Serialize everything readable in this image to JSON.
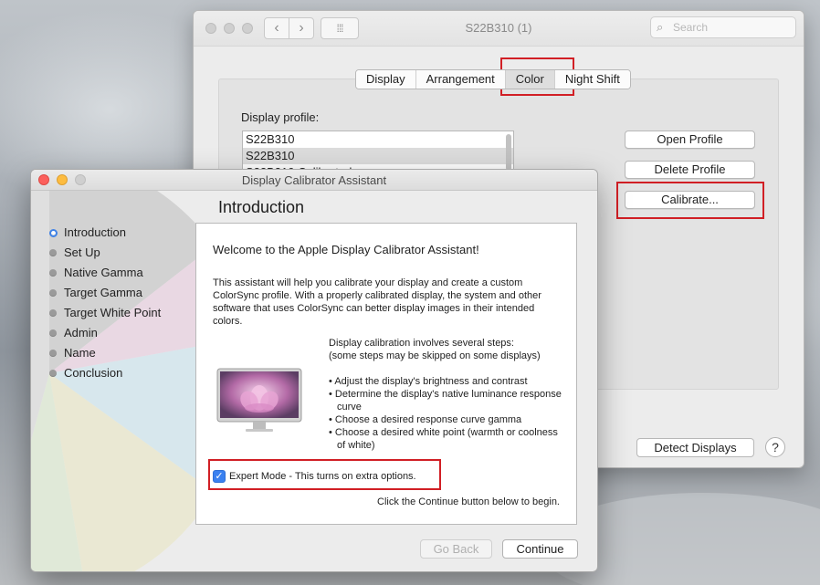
{
  "prefs_window": {
    "title": "S22B310 (1)",
    "search_placeholder": "Search",
    "tabs": [
      {
        "label": "Display",
        "selected": false
      },
      {
        "label": "Arrangement",
        "selected": false
      },
      {
        "label": "Color",
        "selected": true
      },
      {
        "label": "Night Shift",
        "selected": false
      }
    ],
    "display_profile_label": "Display profile:",
    "profiles": [
      "S22B310",
      "S22B310",
      "S22B310 Calibrated"
    ],
    "selected_profile_index": 1,
    "buttons": {
      "open_profile": "Open Profile",
      "delete_profile": "Delete Profile",
      "calibrate": "Calibrate...",
      "detect_displays": "Detect Displays",
      "help": "?"
    }
  },
  "calibrator_window": {
    "title": "Display Calibrator Assistant",
    "heading": "Introduction",
    "steps": [
      "Introduction",
      "Set Up",
      "Native Gamma",
      "Target Gamma",
      "Target White Point",
      "Admin",
      "Name",
      "Conclusion"
    ],
    "current_step_index": 0,
    "welcome": "Welcome to the Apple Display Calibrator Assistant!",
    "intro": "This assistant will help you calibrate your display and create a custom ColorSync profile.  With a properly calibrated display, the system and other software that uses ColorSync can better display images in their intended colors.",
    "steps_heading_1": "Display calibration involves several steps:",
    "steps_heading_2": "(some steps may be skipped on some displays)",
    "bullets": [
      "Adjust the display's brightness and contrast",
      "Determine the display's native luminance response curve",
      "Choose a desired response curve gamma",
      "Choose a desired white point (warmth or coolness of white)"
    ],
    "expert_mode_label": "Expert Mode - This turns on extra options.",
    "expert_mode_checked": true,
    "continue_note": "Click the Continue button below to begin.",
    "buttons": {
      "go_back": "Go Back",
      "continue": "Continue"
    }
  },
  "colors": {
    "highlight": "#d11f25",
    "checkbox_blue": "#3a81f0",
    "close": "#fc605c",
    "minimize": "#fdbc40"
  }
}
